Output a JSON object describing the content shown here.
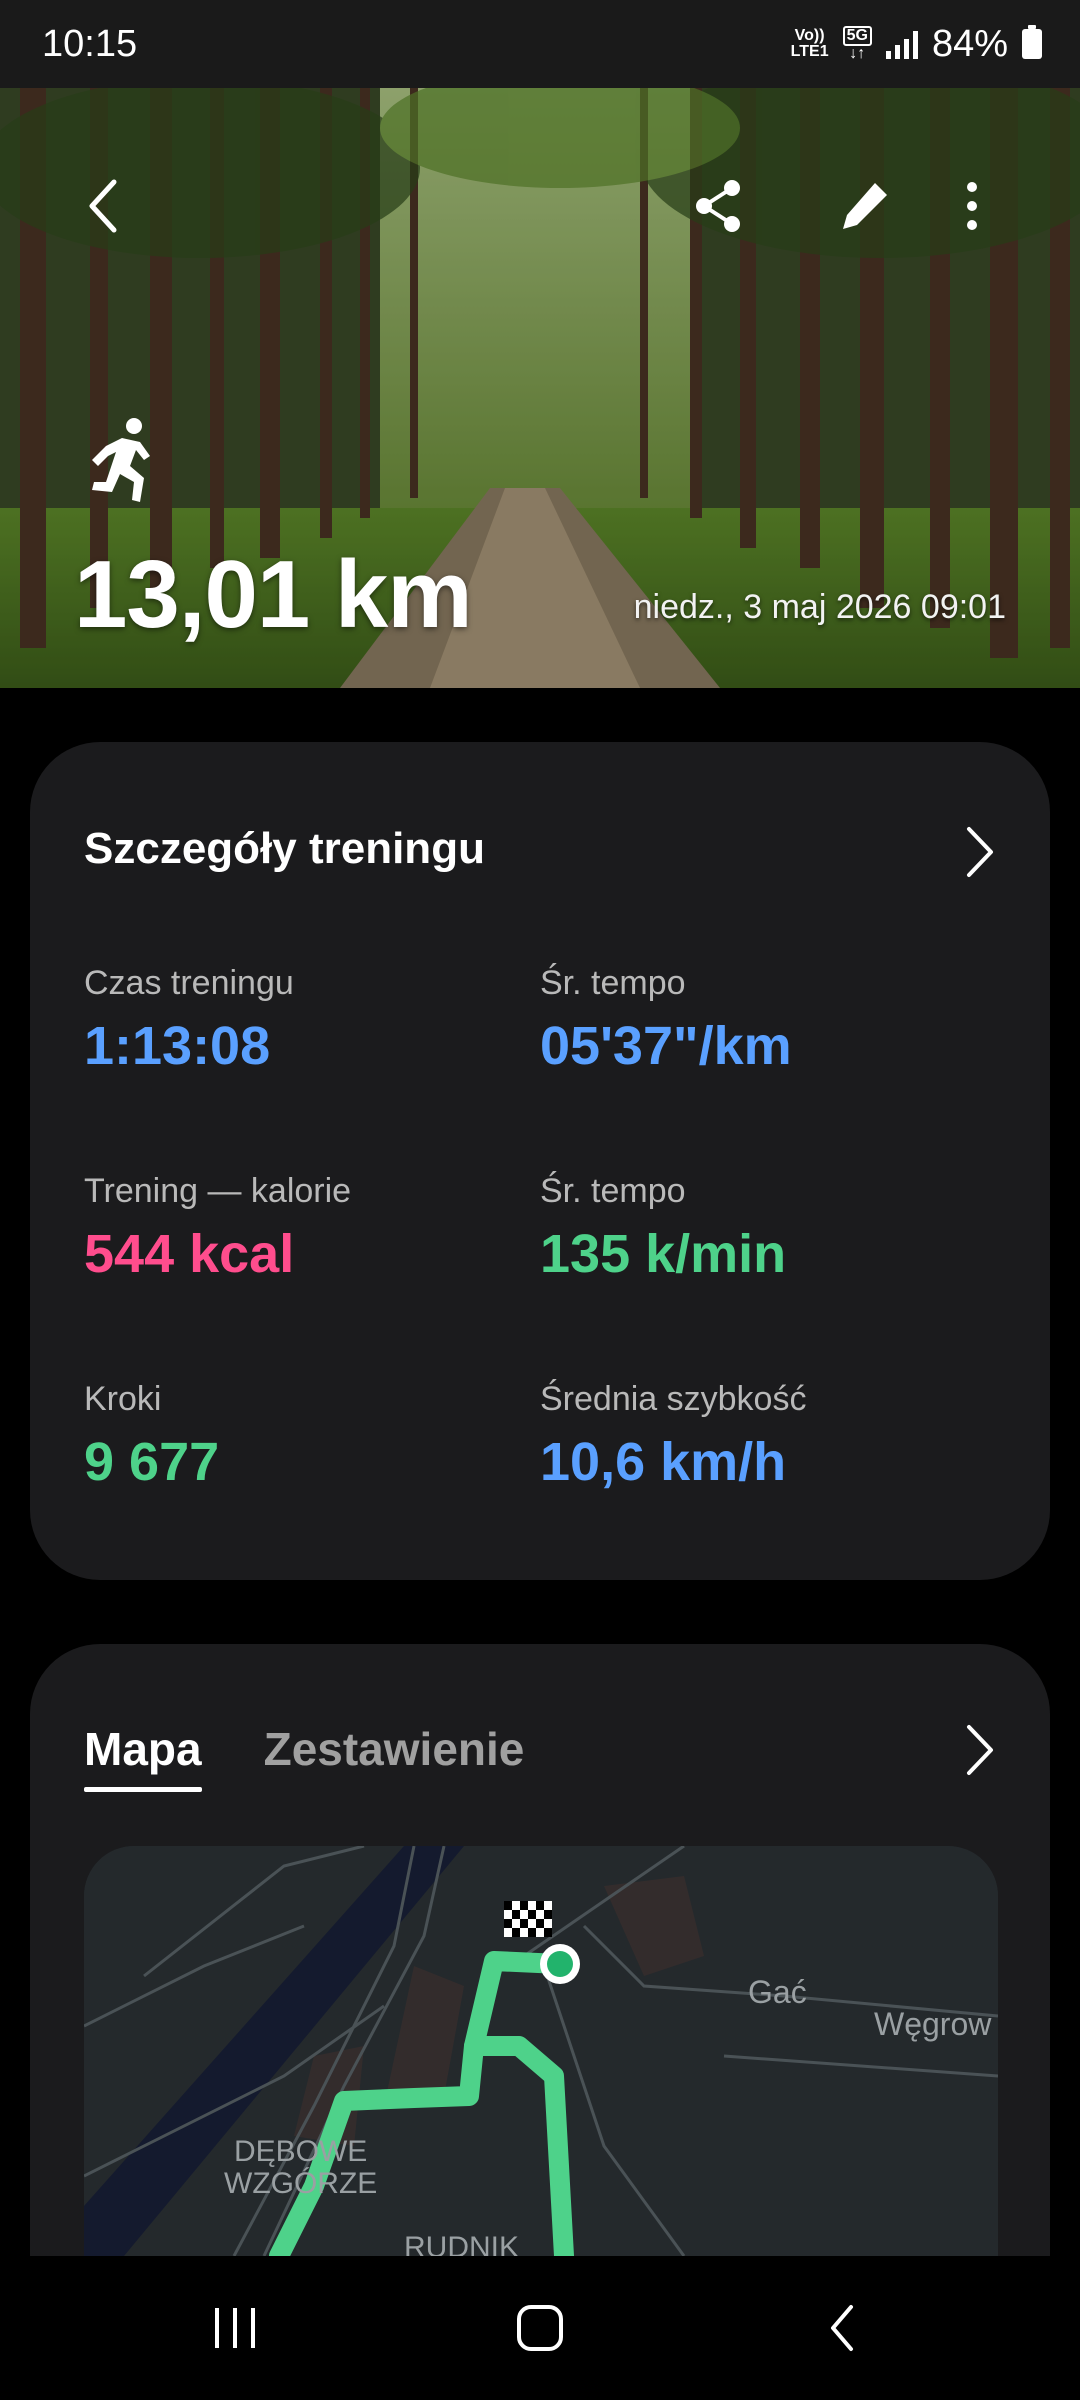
{
  "status_bar": {
    "time": "10:15",
    "network_top": "Vo))",
    "network_bottom": "LTE1",
    "net_5g": "5G",
    "battery": "84%"
  },
  "hero": {
    "distance": "13,01 km",
    "date": "niedz., 3 maj 2026 09:01",
    "icons": [
      "back-icon",
      "share-icon",
      "edit-icon",
      "more-icon",
      "running-icon"
    ]
  },
  "details": {
    "title": "Szczegóły treningu",
    "metrics": [
      {
        "label": "Czas treningu",
        "value": "1:13:08",
        "color": "#5aa0ff"
      },
      {
        "label": "Śr. tempo",
        "value": "05'37\"/km",
        "color": "#5aa0ff"
      },
      {
        "label": "Trening — kalorie",
        "value": "544 kcal",
        "color": "#ff4d8d"
      },
      {
        "label": "Śr. tempo",
        "value": "135 k/min",
        "color": "#4ed28a"
      },
      {
        "label": "Kroki",
        "value": "9 677",
        "color": "#4ed28a"
      },
      {
        "label": "Średnia szybkość",
        "value": "10,6 km/h",
        "color": "#5aa0ff"
      }
    ]
  },
  "map_card": {
    "tabs": [
      "Mapa",
      "Zestawienie"
    ],
    "active_tab": "Mapa",
    "labels": {
      "gac": "Gać",
      "wegrow": "Węgrow",
      "debowe_1": "DĘBOWE",
      "debowe_2": "WZGÓRZE",
      "rudnik": "RUDNIK"
    },
    "route_color": "#4ed28a"
  },
  "nav_bar": {
    "icons": [
      "recent-apps-icon",
      "home-icon",
      "back-nav-icon"
    ]
  }
}
